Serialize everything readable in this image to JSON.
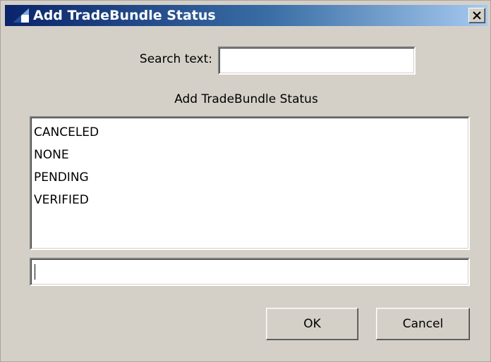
{
  "window": {
    "title": "Add TradeBundle Status",
    "icons": {
      "app": "app-icon",
      "close": "close-icon"
    }
  },
  "search": {
    "label": "Search text:",
    "value": ""
  },
  "section": {
    "label": "Add TradeBundle Status"
  },
  "list": {
    "items": [
      "CANCELED",
      "NONE",
      "PENDING",
      "VERIFIED"
    ]
  },
  "entry": {
    "value": ""
  },
  "buttons": {
    "ok": "OK",
    "cancel": "Cancel"
  },
  "colors": {
    "dialog_bg": "#d4d0c8",
    "title_start": "#0a246a",
    "title_end": "#a6caf0",
    "field_bg": "#ffffff"
  }
}
